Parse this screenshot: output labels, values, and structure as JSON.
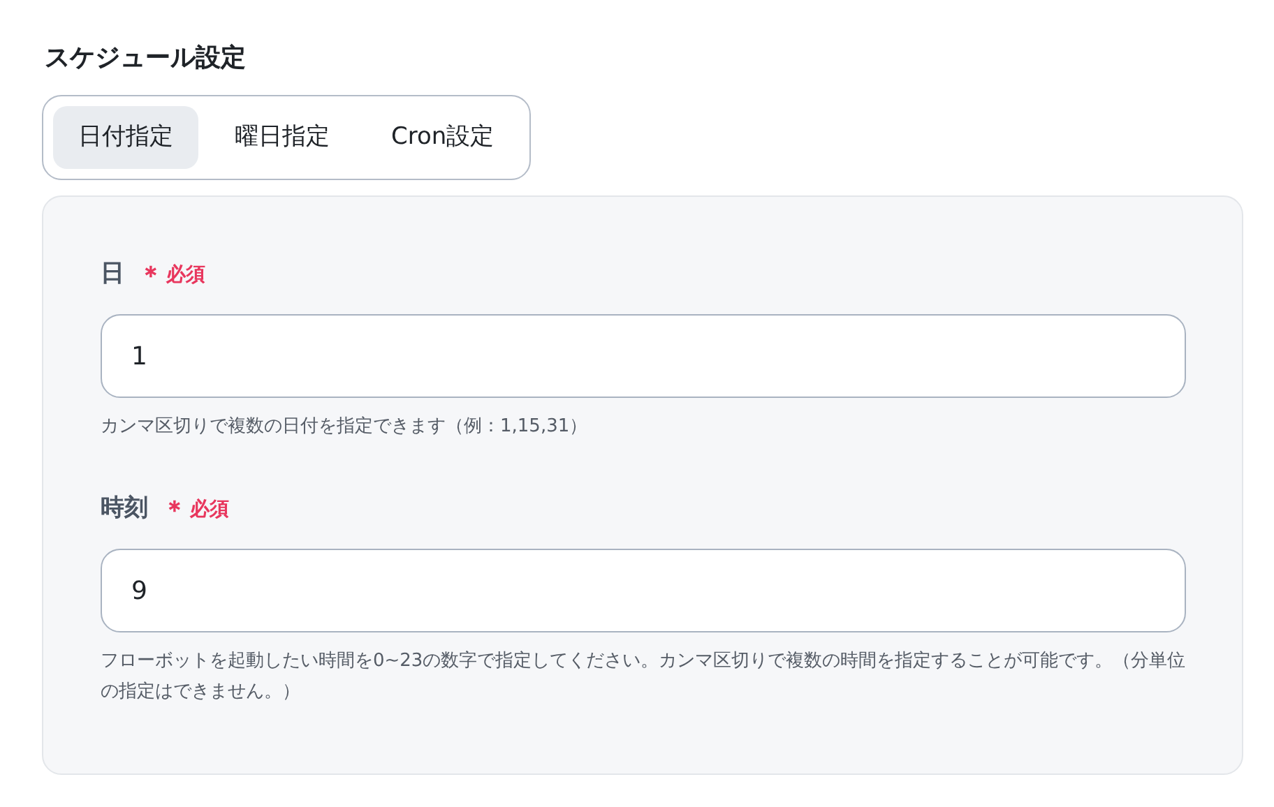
{
  "title": "スケジュール設定",
  "tabs": [
    {
      "label": "日付指定",
      "selected": true
    },
    {
      "label": "曜日指定",
      "selected": false
    },
    {
      "label": "Cron設定",
      "selected": false
    }
  ],
  "fields": [
    {
      "label": "日",
      "required": true,
      "required_mark": "＊",
      "required_label": "必須",
      "value": "1",
      "hint": "カンマ区切りで複数の日付を指定できます（例：1,15,31）"
    },
    {
      "label": "時刻",
      "required": true,
      "required_mark": "＊",
      "required_label": "必須",
      "value": "9",
      "hint": "フローボットを起動したい時間を0~23の数字で指定してください。カンマ区切りで複数の時間を指定することが可能です。（分単位の指定はできません。）"
    }
  ]
}
